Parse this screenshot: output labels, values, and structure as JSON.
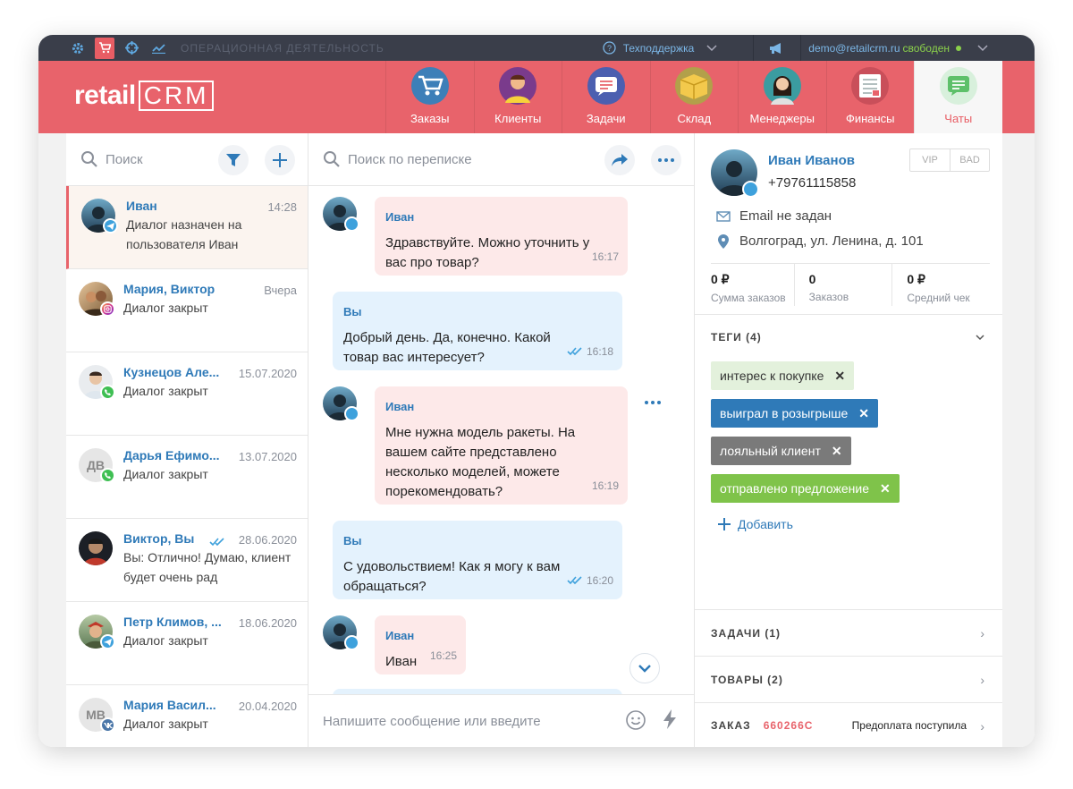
{
  "topbar": {
    "section_title": "ОПЕРАЦИОННАЯ ДЕЯТЕЛЬНОСТЬ",
    "support_label": "Техподдержка",
    "user_email": "demo@retailcrm.ru",
    "user_status": "свободен",
    "icons": [
      "gear-icon",
      "cart-icon",
      "target-icon",
      "analytics-icon"
    ],
    "status_color": "#8bd14a"
  },
  "header": {
    "logo_text": "retail",
    "logo_crm": "CRM",
    "accent_color": "#e8636b",
    "nav": [
      {
        "label": "Заказы",
        "icon": "cart-icon"
      },
      {
        "label": "Клиенты",
        "icon": "customer-icon"
      },
      {
        "label": "Задачи",
        "icon": "tasks-icon"
      },
      {
        "label": "Склад",
        "icon": "box-icon"
      },
      {
        "label": "Менеджеры",
        "icon": "manager-icon"
      },
      {
        "label": "Финансы",
        "icon": "finance-icon"
      },
      {
        "label": "Чаты",
        "icon": "chat-icon"
      }
    ]
  },
  "list": {
    "search_placeholder": "Поиск",
    "items": [
      {
        "name": "Иван",
        "time": "14:28",
        "text": "Диалог назначен на пользователя Иван",
        "channel": "telegram"
      },
      {
        "name": "Мария, Виктор",
        "time": "Вчера",
        "text": "Диалог закрыт",
        "channel": "instagram"
      },
      {
        "name": "Кузнецов Але...",
        "time": "15.07.2020",
        "text": "Диалог закрыт",
        "channel": "whatsapp"
      },
      {
        "name": "Дарья Ефимо...",
        "time": "13.07.2020",
        "text": "Диалог закрыт",
        "channel": "whatsapp",
        "initials": "ДВ"
      },
      {
        "name": "Виктор, Вы",
        "time": "28.06.2020",
        "text": "Вы: Отлично! Думаю, клиент будет очень рад",
        "channel": "none"
      },
      {
        "name": "Петр Климов, ...",
        "time": "18.06.2020",
        "text": "Диалог закрыт",
        "channel": "telegram"
      },
      {
        "name": "Мария Васил...",
        "time": "20.04.2020",
        "text": "Диалог закрыт",
        "channel": "vk",
        "initials": "МВ"
      }
    ]
  },
  "chat": {
    "search_placeholder": "Поиск по переписке",
    "composer_placeholder": "Напишите сообщение или введите",
    "messages": [
      {
        "from": "Иван",
        "text": "Здравствуйте. Можно уточнить у вас про товар?",
        "time": "16:17"
      },
      {
        "from": "Вы",
        "text": "Добрый день. Да, конечно. Какой товар вас интересует?",
        "time": "16:18"
      },
      {
        "from": "Иван",
        "text": "Мне нужна модель ракеты. На вашем сайте представлено несколько моделей, можете порекомендовать?",
        "time": "16:19"
      },
      {
        "from": "Вы",
        "text": "С удовольствием! Как я могу к вам обращаться?",
        "time": "16:20"
      },
      {
        "from": "Иван",
        "text": "Иван",
        "time": "16:25"
      }
    ]
  },
  "profile": {
    "name": "Иван Иванов",
    "phone": "+79761115858",
    "vip_label": "VIP",
    "bad_label": "BAD",
    "email": "Email не задан",
    "address": "Волгоград, ул. Ленина, д. 101",
    "stats": [
      {
        "value": "0 ₽",
        "label": "Сумма заказов"
      },
      {
        "value": "0",
        "label": "Заказов"
      },
      {
        "value": "0 ₽",
        "label": "Средний чек"
      }
    ],
    "tags_title": "ТЕГИ (4)",
    "tags": [
      {
        "label": "интерес к покупке",
        "bg": "#e3f1dc",
        "fg": "#333333"
      },
      {
        "label": "выиграл в розыгрыше",
        "bg": "#2f7ab8",
        "fg": "#ffffff"
      },
      {
        "label": "лояльный клиент",
        "bg": "#7a7a7a",
        "fg": "#ffffff"
      },
      {
        "label": "отправлено предложение",
        "bg": "#7fc34a",
        "fg": "#ffffff"
      }
    ],
    "add_tag_label": "Добавить",
    "tasks_title": "ЗАДАЧИ (1)",
    "goods_title": "ТОВАРЫ (2)",
    "order_title": "ЗАКАЗ",
    "order_number": "660266C",
    "order_status": "Предоплата поступила"
  }
}
